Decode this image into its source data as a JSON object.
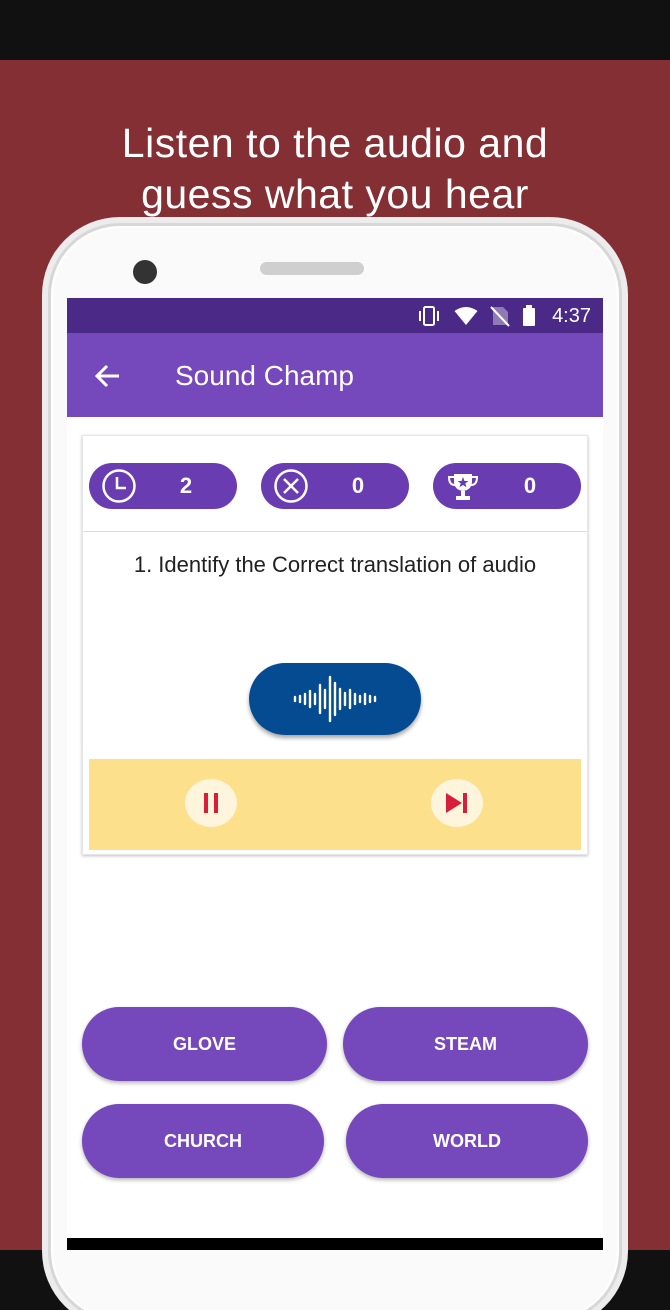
{
  "promo": {
    "headline": "Listen to the audio and\nguess what you hear"
  },
  "status_bar": {
    "time": "4:37",
    "icons": [
      "vibrate-icon",
      "wifi-icon",
      "no-sim-icon",
      "battery-icon"
    ]
  },
  "app_bar": {
    "title": "Sound Champ",
    "back_icon": "arrow-left-icon"
  },
  "stats": {
    "timer": {
      "icon": "clock-icon",
      "value": "2"
    },
    "wrong": {
      "icon": "x-circle-icon",
      "value": "0"
    },
    "score": {
      "icon": "trophy-icon",
      "value": "0"
    }
  },
  "question": {
    "text": "1. Identify the Correct translation of audio"
  },
  "audio": {
    "play_icon": "sound-wave-icon",
    "pause_icon": "pause-icon",
    "next_icon": "skip-next-icon"
  },
  "answers": [
    {
      "label": "GLOVE"
    },
    {
      "label": "STEAM"
    },
    {
      "label": "CHURCH"
    },
    {
      "label": "WORLD"
    }
  ],
  "colors": {
    "promo_background": "#832f33",
    "status_bar": "#4a2a86",
    "app_bar": "#7548bc",
    "pill": "#6a3cb2",
    "audio_button": "#044b92",
    "controls_panel": "#fde08b",
    "control_icon": "#d81e3a"
  }
}
